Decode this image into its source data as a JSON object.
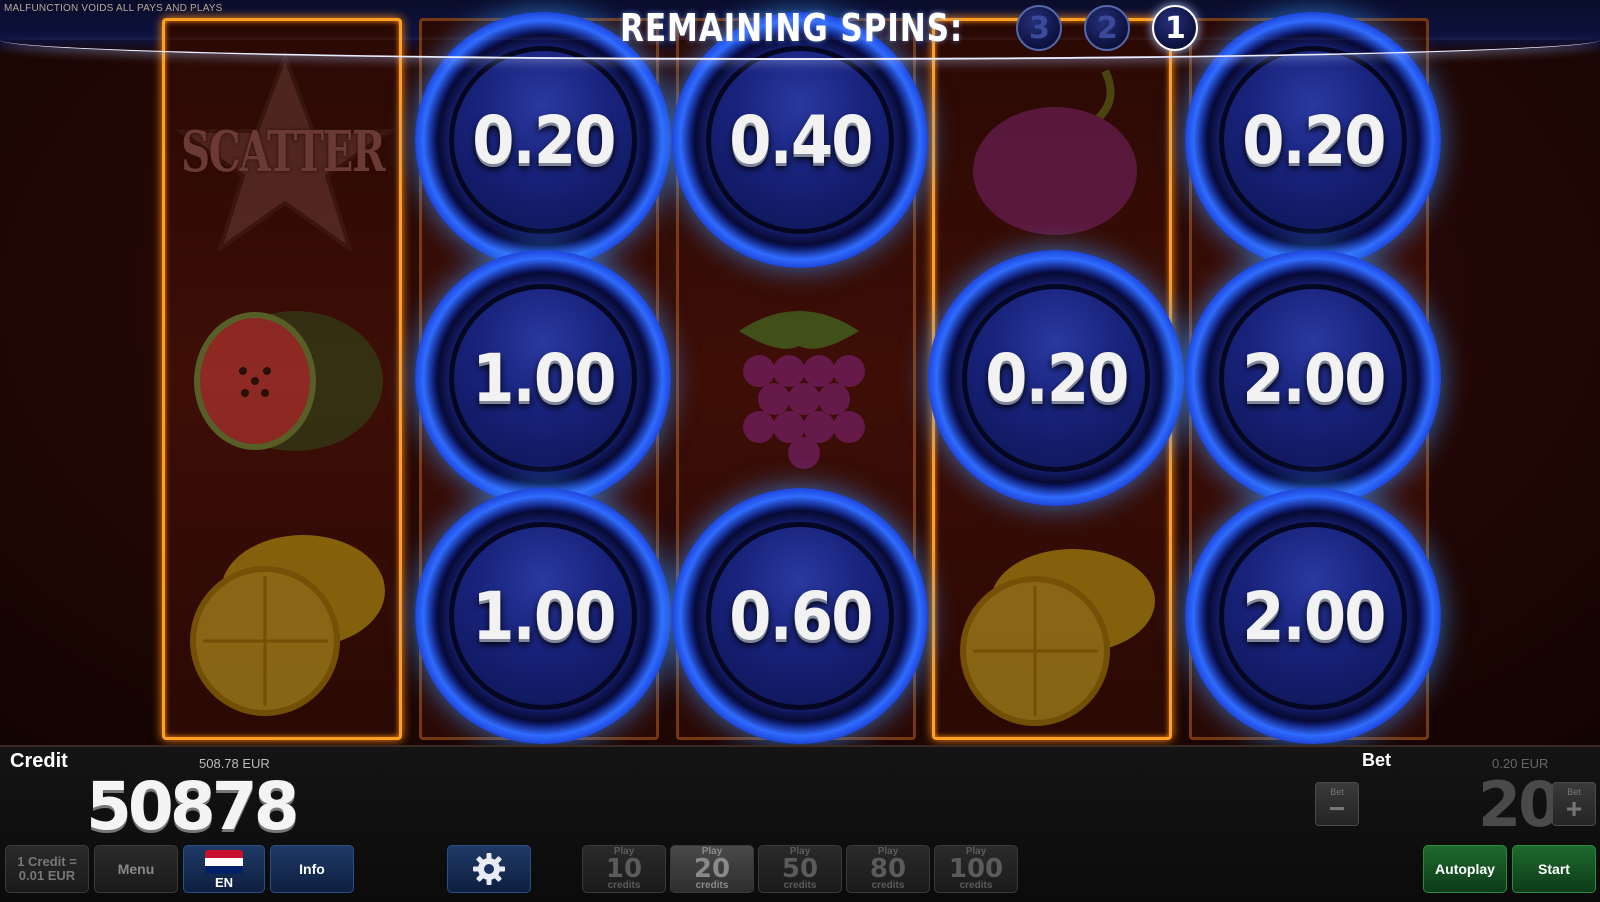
{
  "disclaimer": "MALFUNCTION VOIDS ALL PAYS AND PLAYS",
  "remaining_spins": {
    "label": "REMAINING SPINS:",
    "counters": [
      "3",
      "2",
      "1"
    ],
    "active": "1"
  },
  "reels": {
    "symbols": {
      "scatter_text": "SCATTER"
    },
    "coins": [
      {
        "value": "0.20"
      },
      {
        "value": "0.40"
      },
      {
        "value": "0.20"
      },
      {
        "value": "1.00"
      },
      {
        "value": "0.20"
      },
      {
        "value": "2.00"
      },
      {
        "value": "1.00"
      },
      {
        "value": "0.60"
      },
      {
        "value": "2.00"
      }
    ]
  },
  "panel": {
    "credit_label": "Credit",
    "credit_eur": "508.78 EUR",
    "credit_value": "50878",
    "bet_label": "Bet",
    "bet_eur": "0.20 EUR",
    "bet_value": "20",
    "bet_minus_caption": "Bet",
    "bet_minus_symbol": "−",
    "bet_plus_caption": "Bet",
    "bet_plus_symbol": "+",
    "credit_rate_line1": "1 Credit =",
    "credit_rate_line2": "0.01 EUR",
    "menu_label": "Menu",
    "language_label": "EN",
    "info_label": "Info",
    "play_buttons": [
      {
        "top": "Play",
        "number": "10",
        "bottom": "credits"
      },
      {
        "top": "Play",
        "number": "20",
        "bottom": "credits"
      },
      {
        "top": "Play",
        "number": "50",
        "bottom": "credits"
      },
      {
        "top": "Play",
        "number": "80",
        "bottom": "credits"
      },
      {
        "top": "Play",
        "number": "100",
        "bottom": "credits"
      }
    ],
    "selected_play": "20",
    "autoplay_label": "Autoplay",
    "start_label": "Start"
  },
  "colors": {
    "coin_blue": "#1f2a80",
    "reel_highlight": "#ffa020",
    "autoplay_green": "#1e6a2e",
    "info_blue": "#1f3a66"
  },
  "icons": {
    "settings": "gear-icon",
    "language": "flag-icon"
  }
}
